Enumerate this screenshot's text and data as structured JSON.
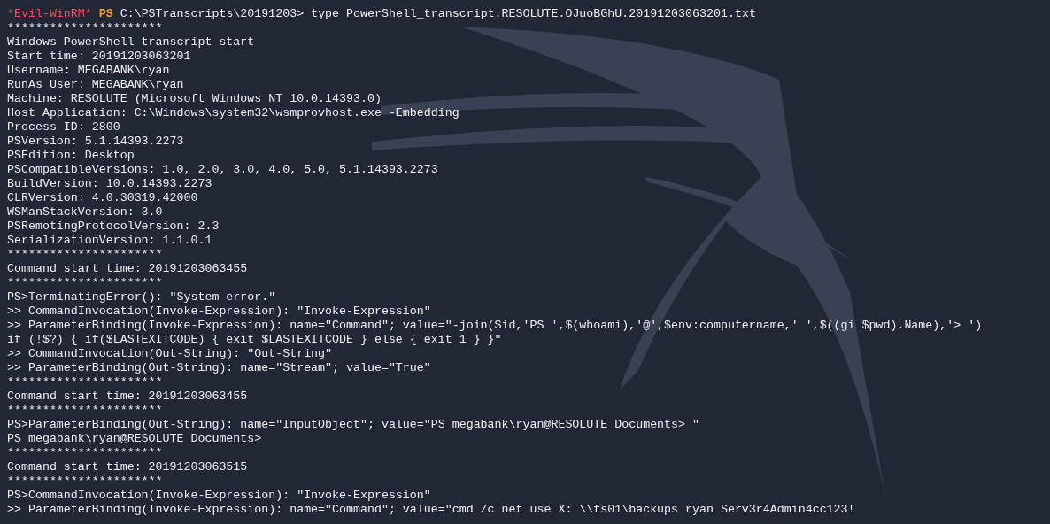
{
  "prompt": {
    "tag": "*Evil-WinRM*",
    "shell": "PS",
    "path": "C:\\PSTranscripts\\20191203>",
    "command": "type PowerShell_transcript.RESOLUTE.OJuoBGhU.20191203063201.txt"
  },
  "output_lines": [
    "**********************",
    "Windows PowerShell transcript start",
    "Start time: 20191203063201",
    "Username: MEGABANK\\ryan",
    "RunAs User: MEGABANK\\ryan",
    "Machine: RESOLUTE (Microsoft Windows NT 10.0.14393.0)",
    "Host Application: C:\\Windows\\system32\\wsmprovhost.exe -Embedding",
    "Process ID: 2800",
    "PSVersion: 5.1.14393.2273",
    "PSEdition: Desktop",
    "PSCompatibleVersions: 1.0, 2.0, 3.0, 4.0, 5.0, 5.1.14393.2273",
    "BuildVersion: 10.0.14393.2273",
    "CLRVersion: 4.0.30319.42000",
    "WSManStackVersion: 3.0",
    "PSRemotingProtocolVersion: 2.3",
    "SerializationVersion: 1.1.0.1",
    "**********************",
    "Command start time: 20191203063455",
    "**********************",
    "PS>TerminatingError(): \"System error.\"",
    ">> CommandInvocation(Invoke-Expression): \"Invoke-Expression\"",
    ">> ParameterBinding(Invoke-Expression): name=\"Command\"; value=\"-join($id,'PS ',$(whoami),'@',$env:computername,' ',$((gi $pwd).Name),'> ')",
    "if (!$?) { if($LASTEXITCODE) { exit $LASTEXITCODE } else { exit 1 } }\"",
    ">> CommandInvocation(Out-String): \"Out-String\"",
    ">> ParameterBinding(Out-String): name=\"Stream\"; value=\"True\"",
    "**********************",
    "Command start time: 20191203063455",
    "**********************",
    "PS>ParameterBinding(Out-String): name=\"InputObject\"; value=\"PS megabank\\ryan@RESOLUTE Documents> \"",
    "PS megabank\\ryan@RESOLUTE Documents>",
    "**********************",
    "Command start time: 20191203063515",
    "**********************",
    "PS>CommandInvocation(Invoke-Expression): \"Invoke-Expression\"",
    ">> ParameterBinding(Invoke-Expression): name=\"Command\"; value=\"cmd /c net use X: \\\\fs01\\backups ryan Serv3r4Admin4cc123!"
  ]
}
